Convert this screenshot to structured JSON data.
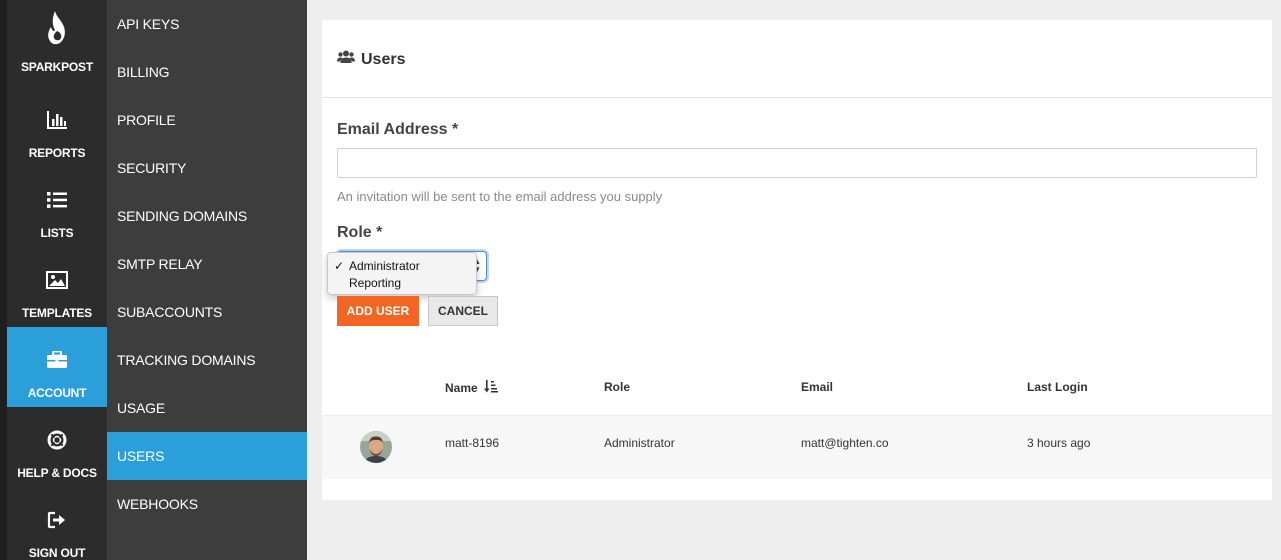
{
  "rail": {
    "brand": "SPARKPOST",
    "items": [
      {
        "label": "REPORTS",
        "icon": "bar-chart-icon"
      },
      {
        "label": "LISTS",
        "icon": "list-icon"
      },
      {
        "label": "TEMPLATES",
        "icon": "image-icon"
      },
      {
        "label": "ACCOUNT",
        "icon": "briefcase-icon"
      },
      {
        "label": "HELP & DOCS",
        "icon": "life-ring-icon"
      },
      {
        "label": "SIGN OUT",
        "icon": "sign-out-icon"
      }
    ],
    "active": "ACCOUNT"
  },
  "subnav": {
    "items": [
      "API KEYS",
      "BILLING",
      "PROFILE",
      "SECURITY",
      "SENDING DOMAINS",
      "SMTP RELAY",
      "SUBACCOUNTS",
      "TRACKING DOMAINS",
      "USAGE",
      "USERS",
      "WEBHOOKS"
    ],
    "active": "USERS"
  },
  "panel": {
    "title": "Users",
    "title_icon": "users-icon"
  },
  "form": {
    "email_label": "Email Address *",
    "email_value": "",
    "hint": "An invitation will be sent to the email address you supply",
    "role_label": "Role *",
    "role_options": [
      "Administrator",
      "Reporting"
    ],
    "role_selected": "Administrator",
    "add_button": "ADD USER",
    "cancel_button": "CANCEL"
  },
  "table": {
    "headers": {
      "name": "Name",
      "role": "Role",
      "email": "Email",
      "last_login": "Last Login"
    },
    "sort_icon": "sort-alpha-icon",
    "rows": [
      {
        "name": "matt-8196",
        "role": "Administrator",
        "email": "matt@tighten.co",
        "last_login": "3 hours ago"
      }
    ]
  },
  "colors": {
    "rail_bg": "#2c2c2c",
    "subnav_bg": "#3d3d3d",
    "active_blue": "#2b9fd9",
    "add_orange": "#f26522"
  }
}
